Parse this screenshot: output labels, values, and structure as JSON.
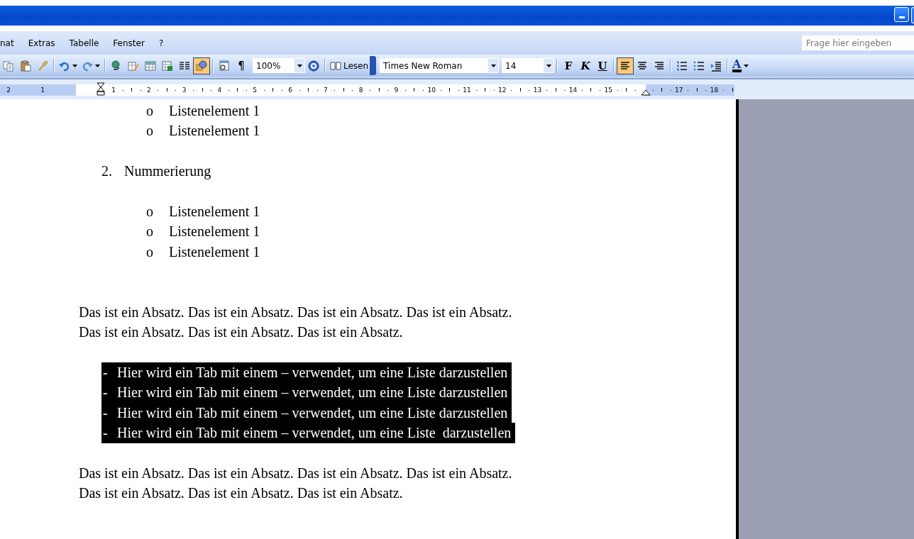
{
  "menu": {
    "items": [
      "nat",
      "Extras",
      "Tabelle",
      "Fenster",
      "?"
    ],
    "question_placeholder": "Frage hier eingeben"
  },
  "toolbar": {
    "buttons": [
      {
        "selected": false
      },
      {
        "selected": false
      },
      {
        "selected": false
      },
      {
        "selected": false
      },
      {
        "selected": false
      },
      {
        "selected": false
      },
      {
        "selected": false
      },
      {
        "selected": false
      },
      {
        "selected": false
      },
      {
        "selected": false
      },
      {
        "selected": true
      },
      {
        "selected": false
      },
      {
        "selected": false
      }
    ],
    "pilcrow": "¶",
    "zoom": "100%",
    "read_button": "Lesen",
    "font": "Times New Roman",
    "font_size": "14",
    "bold": "F",
    "italic": "K",
    "underline": "U",
    "align": [
      {
        "selected": true
      },
      {
        "selected": false
      },
      {
        "selected": false
      }
    ],
    "font_color_letter": "A"
  },
  "ruler": {
    "left_labels": [
      "2",
      "1"
    ],
    "labels": [
      "1",
      "2",
      "3",
      "4",
      "5",
      "6",
      "7",
      "8",
      "9",
      "10",
      "11",
      "12",
      "13",
      "14",
      "15"
    ],
    "labels_after_marker": [
      "17",
      "18"
    ]
  },
  "document": {
    "blocks": [
      {
        "kind": "bullet",
        "marker": "o",
        "text": "Listenelement 1"
      },
      {
        "kind": "bullet",
        "marker": "o",
        "text": "Listenelement 1"
      },
      {
        "kind": "gap"
      },
      {
        "kind": "numbered",
        "marker": "2.",
        "text": "Nummerierung"
      },
      {
        "kind": "gap"
      },
      {
        "kind": "bullet",
        "marker": "o",
        "text": "Listenelement 1"
      },
      {
        "kind": "bullet",
        "marker": "o",
        "text": "Listenelement 1"
      },
      {
        "kind": "bullet",
        "marker": "o",
        "text": "Listenelement 1"
      },
      {
        "kind": "gap"
      },
      {
        "kind": "gap"
      },
      {
        "kind": "paragraph",
        "text": "Das ist ein Absatz. Das ist ein Absatz. Das ist ein Absatz. Das ist ein Absatz."
      },
      {
        "kind": "paragraph",
        "text": "Das ist ein Absatz. Das ist ein Absatz. Das ist ein Absatz."
      },
      {
        "kind": "gap"
      },
      {
        "kind": "dash",
        "marker": "-",
        "text": "Hier wird ein Tab mit einem – verwendet, um eine Liste darzustellen",
        "selected": true
      },
      {
        "kind": "dash",
        "marker": "-",
        "text": "Hier wird ein Tab mit einem – verwendet, um eine Liste darzustellen",
        "selected": true
      },
      {
        "kind": "dash",
        "marker": "-",
        "text": "Hier wird ein Tab mit einem – verwendet, um eine Liste darzustellen",
        "selected": true
      },
      {
        "kind": "dash",
        "marker": "-",
        "text": "Hier wird ein Tab mit einem – verwendet, um eine Liste  darzustellen",
        "selected": true
      },
      {
        "kind": "gap"
      },
      {
        "kind": "paragraph",
        "text": "Das ist ein Absatz. Das ist ein Absatz. Das ist ein Absatz. Das ist ein Absatz."
      },
      {
        "kind": "paragraph",
        "text": "Das ist ein Absatz. Das ist ein Absatz. Das ist ein Absatz."
      }
    ]
  }
}
